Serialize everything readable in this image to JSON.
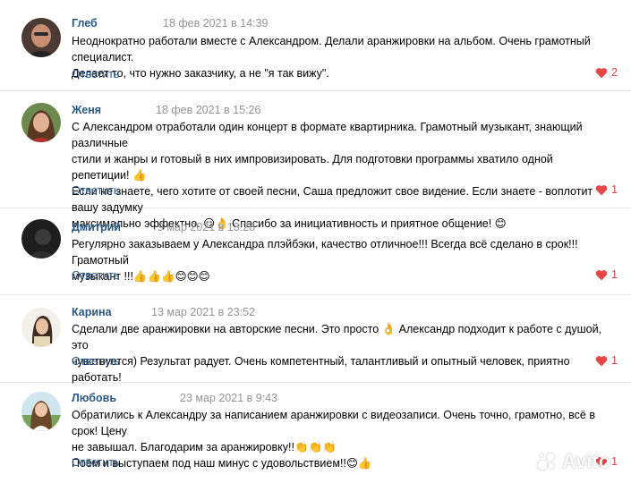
{
  "comments": [
    {
      "name": "Глеб",
      "date": "18 фев 2021 в 14:39",
      "lines": [
        "Неоднократно работали вместе с Александром. Делали аранжировки на альбом. Очень грамотный специалист.",
        "Делает то, что нужно заказчику, а не \"я так вижу\"."
      ],
      "reply_label": "Ответить",
      "likes": "2"
    },
    {
      "name": "Женя",
      "date": "18 фев 2021 в 15:26",
      "lines": [
        "С Александром отработали один концерт в формате квартирника. Грамотный музыкант, знающий различные",
        "стили и жанры и готовый в них импровизировать. Для подготовки программы хватило одной репетиции! 👍",
        "Если не знаете, чего хотите от своей песни, Саша предложит свое видение. Если знаете - воплотит вашу задумку",
        "максимально эффектно. 😏👌 Спасибо за инициативность и приятное общение! 😊"
      ],
      "reply_label": "Ответить",
      "likes": "1"
    },
    {
      "name": "Дмитрий",
      "date": "9 мар 2021 в 13:28",
      "lines": [
        "Регулярно заказываем у Александра плэйбэки, качество отличное!!! Всегда всё сделано в срок!!! Грамотный",
        "музыкант !!!👍👍👍😊😊😊"
      ],
      "reply_label": "Ответить",
      "likes": "1"
    },
    {
      "name": "Карина",
      "date": "13 мар 2021 в 23:52",
      "lines": [
        "Сделали две аранжировки на авторские песни. Это просто 👌 Александр подходит к работе с душой, это",
        "чувствуется) Результат радует. Очень компетентный, талантливый и опытный человек, приятно работать!"
      ],
      "reply_label": "Ответить",
      "likes": "1"
    },
    {
      "name": "Любовь",
      "date": "23 мар 2021 в 9:43",
      "lines": [
        "Обратились к Александру за написанием аранжировки с видеозаписи. Очень точно, грамотно, всё в срок! Цену",
        "не завышал. Благодарим за аранжировку!!👏👏👏",
        "Поём и выступаем под наш минус с удовольствием!!😊👍"
      ],
      "reply_label": "Ответить",
      "likes": "1"
    }
  ],
  "watermark": "Avito",
  "colors": {
    "link": "#2a5885",
    "date": "#939393",
    "like": "#e64646",
    "divider": "#e7e8ec"
  }
}
